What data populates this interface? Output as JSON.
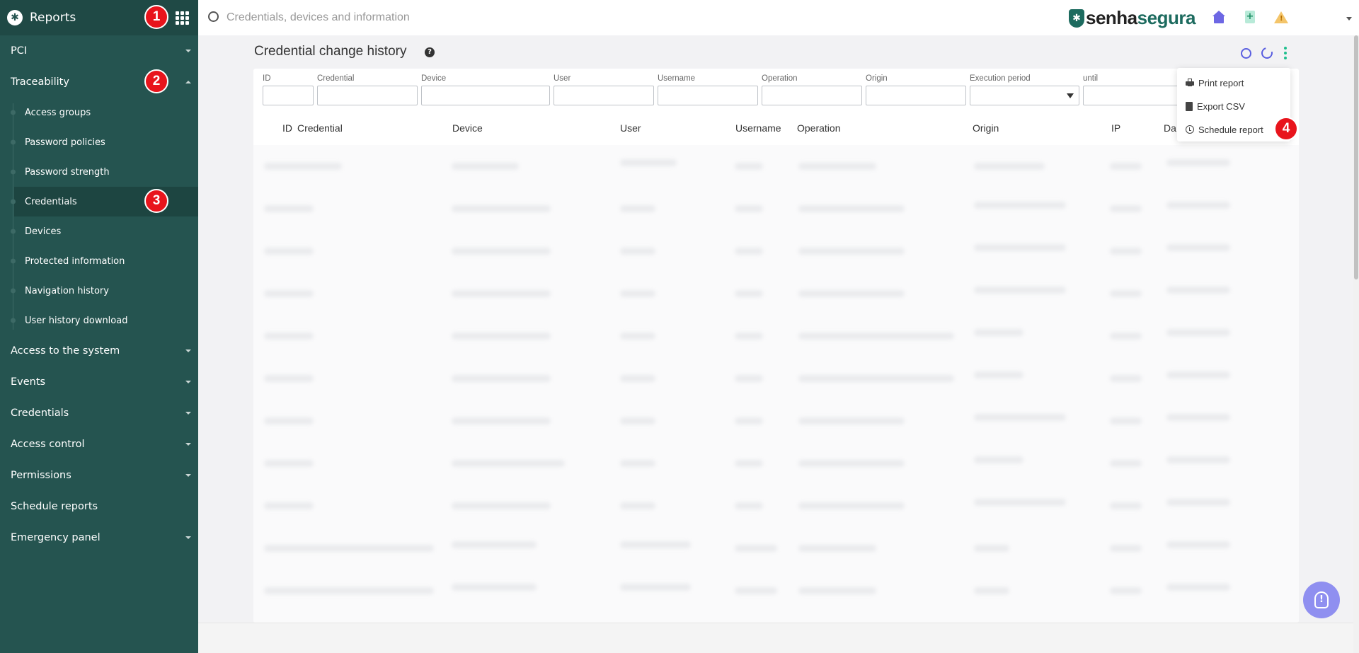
{
  "sidebar": {
    "title": "Reports",
    "items": [
      {
        "label": "PCI",
        "expanded": false
      },
      {
        "label": "Traceability",
        "expanded": true
      },
      {
        "label": "Access to the system",
        "expanded": false
      },
      {
        "label": "Events",
        "expanded": false
      },
      {
        "label": "Credentials",
        "expanded": false
      },
      {
        "label": "Access control",
        "expanded": false
      },
      {
        "label": "Permissions",
        "expanded": false
      },
      {
        "label": "Schedule reports"
      },
      {
        "label": "Emergency panel",
        "expanded": false
      }
    ],
    "sub_items": [
      "Access groups",
      "Password policies",
      "Password strength",
      "Credentials",
      "Devices",
      "Protected information",
      "Navigation history",
      "User history download"
    ],
    "active_sub_item": "Credentials"
  },
  "topbar": {
    "search_placeholder": "Credentials, devices and information",
    "brand_part1": "senha",
    "brand_part2": "segura"
  },
  "page": {
    "title": "Credential change history"
  },
  "filters": [
    "ID",
    "Credential",
    "Device",
    "User",
    "Username",
    "Operation",
    "Origin",
    "Execution period",
    "until"
  ],
  "table": {
    "columns": [
      "ID",
      "Credential",
      "Device",
      "User",
      "Username",
      "Operation",
      "Origin",
      "IP",
      "Da"
    ]
  },
  "menu": {
    "items": [
      "Print report",
      "Export CSV",
      "Schedule report"
    ]
  },
  "markers": [
    "1",
    "2",
    "3",
    "4"
  ],
  "colors": {
    "sidebar_bg": "#255450",
    "accent_blue": "#5a5fe0",
    "accent_green": "#1d6b5f",
    "marker_red": "#e8141c"
  }
}
